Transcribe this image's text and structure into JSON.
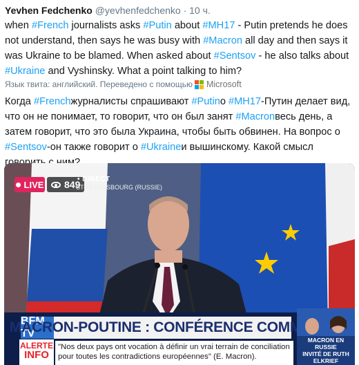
{
  "tweet": {
    "author_name": "Yevhen Fedchenko",
    "handle": "@yevhenfedchenko",
    "separator": "·",
    "time": "10 ч.",
    "en_segments": [
      {
        "text": "when ",
        "tag": false
      },
      {
        "text": "#French",
        "tag": true
      },
      {
        "text": " journalists asks ",
        "tag": false
      },
      {
        "text": "#Putin",
        "tag": true
      },
      {
        "text": "  about ",
        "tag": false
      },
      {
        "text": "#MH17",
        "tag": true
      },
      {
        "text": "  - Putin pretends he does not understand, then says he was busy with ",
        "tag": false
      },
      {
        "text": "#Macron",
        "tag": true
      },
      {
        "text": " all day and then says it was Ukraine to be blamed. When asked about ",
        "tag": false
      },
      {
        "text": "#Sentsov",
        "tag": true
      },
      {
        "text": "  - he also talks about ",
        "tag": false
      },
      {
        "text": "#Ukraine",
        "tag": true
      },
      {
        "text": " and Vyshinsky. What a point talking to him?",
        "tag": false
      }
    ],
    "translation_note": "Язык твита: английский. Переведено с помощью",
    "translator_name": "Microsoft",
    "ru_segments": [
      {
        "text": "Когда ",
        "tag": false
      },
      {
        "text": "#French",
        "tag": true
      },
      {
        "text": "журналисты спрашивают ",
        "tag": false
      },
      {
        "text": "#Putin",
        "tag": true
      },
      {
        "text": "о ",
        "tag": false
      },
      {
        "text": "#MH17",
        "tag": true
      },
      {
        "text": "-Путин делает вид, что он не понимает, то говорит, что он был занят ",
        "tag": false
      },
      {
        "text": "#Macron",
        "tag": true
      },
      {
        "text": "весь день, а затем говорит, что это была Украина, чтобы быть обвинен. На вопрос о ",
        "tag": false
      },
      {
        "text": "#Sentsov",
        "tag": true
      },
      {
        "text": "-он также говорит о ",
        "tag": false
      },
      {
        "text": "#Ukraine",
        "tag": true
      },
      {
        "text": "и вышинскому. Какой смысл говорить с ним?",
        "tag": false
      }
    ]
  },
  "colors": {
    "hashtag": "#1da1f2",
    "live": "#e0245e",
    "ms_red": "#f25022",
    "ms_green": "#7fba00",
    "ms_blue": "#00a4ef",
    "ms_yellow": "#ffb900"
  },
  "video": {
    "live_label": "LIVE",
    "viewer_count": "849",
    "direct_label": "• DIRECT",
    "location_label": "ST-PETERSBOURG (RUSSIE)",
    "channel_logo": "BFM TV",
    "headline": "MACRON-POUTINE : CONFÉRENCE COMMUNE.",
    "alert_top": "ALERTE",
    "alert_bottom": "INFO",
    "quote": "\"Nos deux pays ont vocation à définir un vrai terrain de conciliation pour toutes les contradictions européennes\" (E. Macron).",
    "inset_caption_1": "MACRON EN RUSSIE",
    "inset_caption_2": "INVITÉ DE RUTH ELKRIEF"
  }
}
